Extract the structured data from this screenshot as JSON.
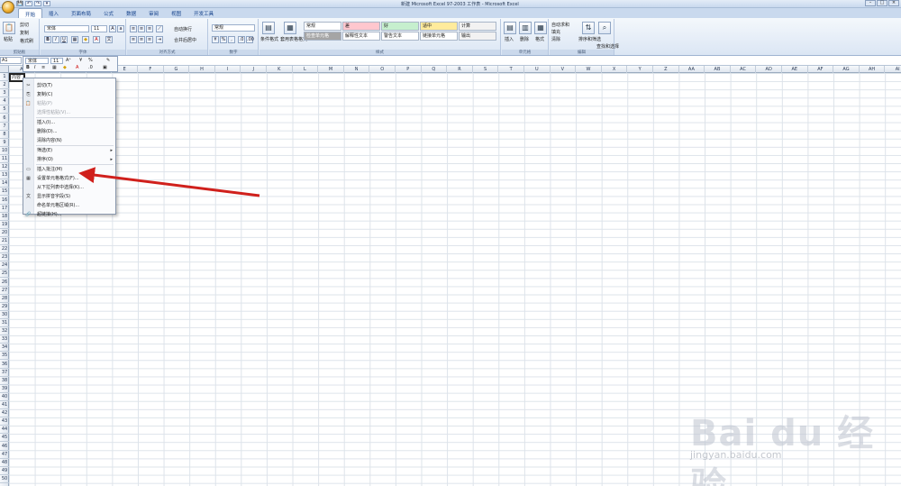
{
  "titlebar": {
    "title": "新建 Microsoft Excel 97-2003 工作表 - Microsoft Excel",
    "controls": [
      "–",
      "□",
      "×"
    ]
  },
  "qat": [
    "💾",
    "↶",
    "↷",
    "▾"
  ],
  "tabs": [
    "开始",
    "插入",
    "页面布局",
    "公式",
    "数据",
    "审阅",
    "视图",
    "开发工具"
  ],
  "ribbon": {
    "clipboard": {
      "paste": "粘贴",
      "cut": "剪切",
      "copy": "复制",
      "format_painter": "格式刷",
      "label": "剪贴板"
    },
    "font": {
      "name": "宋体",
      "size": "11",
      "label": "字体",
      "bold": "B",
      "italic": "I",
      "underline": "U"
    },
    "align": {
      "wrap": "自动换行",
      "merge": "合并后居中",
      "label": "对齐方式"
    },
    "number": {
      "format": "常规",
      "label": "数字"
    },
    "styles": {
      "cond": "条件格式",
      "table": "套用表格格式",
      "label": "样式",
      "cells": [
        {
          "text": "常规",
          "bg": "#ffffff"
        },
        {
          "text": "差",
          "bg": "#ffc7ce"
        },
        {
          "text": "好",
          "bg": "#c6efce"
        },
        {
          "text": "适中",
          "bg": "#ffeb9c"
        },
        {
          "text": "计算",
          "bg": "#f2f2f2"
        },
        {
          "text": "检查单元格",
          "bg": "#a5a5a5"
        },
        {
          "text": "解释性文本",
          "bg": "#ffffff"
        },
        {
          "text": "警告文本",
          "bg": "#ffffff"
        },
        {
          "text": "链接单元格",
          "bg": "#ffffff"
        },
        {
          "text": "输出",
          "bg": "#f2f2f2"
        }
      ]
    },
    "cells_grp": {
      "insert": "插入",
      "delete": "删除",
      "format": "格式",
      "label": "单元格"
    },
    "edit": {
      "autosum": "自动求和",
      "fill": "填充",
      "clear": "清除",
      "sort": "排序和筛选",
      "find": "查找和选择",
      "label": "编辑"
    }
  },
  "namebox": "A1",
  "minibar": {
    "font": "宋体",
    "size": "11",
    "bold": "B",
    "italic": "I"
  },
  "cell_a1": "内容",
  "columns": [
    "A",
    "B",
    "C",
    "D",
    "E",
    "F",
    "G",
    "H",
    "I",
    "J",
    "K",
    "L",
    "M",
    "N",
    "O",
    "P",
    "Q",
    "R",
    "S",
    "T",
    "U",
    "V",
    "W",
    "X",
    "Y",
    "Z",
    "AA",
    "AB",
    "AC",
    "AD",
    "AE",
    "AF",
    "AG",
    "AH",
    "AI"
  ],
  "rows": [
    "1",
    "2",
    "3",
    "4",
    "5",
    "6",
    "7",
    "8",
    "9",
    "10",
    "11",
    "12",
    "13",
    "14",
    "15",
    "16",
    "17",
    "18",
    "19",
    "20",
    "21",
    "22",
    "23",
    "24",
    "25",
    "26",
    "27",
    "28",
    "29",
    "30",
    "31",
    "32",
    "33",
    "34",
    "35",
    "36",
    "37",
    "38",
    "39",
    "40",
    "41",
    "42",
    "43",
    "44",
    "45",
    "46",
    "47",
    "48",
    "49",
    "50"
  ],
  "context_menu": [
    {
      "label": "剪切(T)",
      "icon": "✂",
      "disabled": false
    },
    {
      "label": "复制(C)",
      "icon": "⎘",
      "disabled": false
    },
    {
      "label": "粘贴(P)",
      "icon": "📋",
      "disabled": true
    },
    {
      "label": "选择性粘贴(V)...",
      "icon": "",
      "disabled": true
    },
    {
      "label": "插入(I)...",
      "icon": "",
      "disabled": false
    },
    {
      "label": "删除(D)...",
      "icon": "",
      "disabled": false
    },
    {
      "label": "清除内容(N)",
      "icon": "",
      "disabled": false
    },
    {
      "label": "筛选(E)",
      "icon": "",
      "disabled": false,
      "submenu": true
    },
    {
      "label": "排序(O)",
      "icon": "",
      "disabled": false,
      "submenu": true
    },
    {
      "label": "插入批注(M)",
      "icon": "▭",
      "disabled": false
    },
    {
      "label": "设置单元格格式(F)...",
      "icon": "▦",
      "disabled": false
    },
    {
      "label": "从下拉列表中选择(K)...",
      "icon": "",
      "disabled": false
    },
    {
      "label": "显示拼音字段(S)",
      "icon": "文",
      "disabled": false
    },
    {
      "label": "命名单元格区域(R)...",
      "icon": "",
      "disabled": false
    },
    {
      "label": "超链接(H)...",
      "icon": "🔗",
      "disabled": false
    }
  ],
  "watermark": {
    "text": "Bai du 经验",
    "url": "jingyan.baidu.com"
  },
  "colors": {
    "arrow": "#d0201c",
    "ribbon": "#dbe6f4",
    "tabbar": "#c9d9ee"
  }
}
